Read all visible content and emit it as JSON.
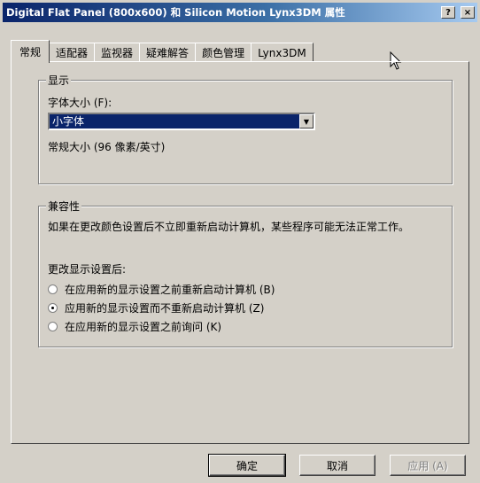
{
  "window": {
    "title": "Digital Flat Panel (800x600) 和 Silicon Motion Lynx3DM 属性",
    "help_label": "?",
    "close_label": "×"
  },
  "tabs": [
    {
      "label": "常规",
      "active": true
    },
    {
      "label": "适配器",
      "active": false
    },
    {
      "label": "监视器",
      "active": false
    },
    {
      "label": "疑难解答",
      "active": false
    },
    {
      "label": "颜色管理",
      "active": false
    },
    {
      "label": "Lynx3DM",
      "active": false
    }
  ],
  "display_group": {
    "title": "显示",
    "font_size_label": "字体大小 (F):",
    "font_size_value": "小字体",
    "font_note": "常规大小 (96 像素/英寸)"
  },
  "compat_group": {
    "title": "兼容性",
    "description": "如果在更改颜色设置后不立即重新启动计算机，某些程序可能无法正常工作。",
    "after_change_label": "更改显示设置后:",
    "options": [
      {
        "label": "在应用新的显示设置之前重新启动计算机 (B)",
        "selected": false
      },
      {
        "label": "应用新的显示设置而不重新启动计算机 (Z)",
        "selected": true
      },
      {
        "label": "在应用新的显示设置之前询问 (K)",
        "selected": false
      }
    ]
  },
  "buttons": {
    "ok": "确定",
    "cancel": "取消",
    "apply": "应用 (A)"
  }
}
